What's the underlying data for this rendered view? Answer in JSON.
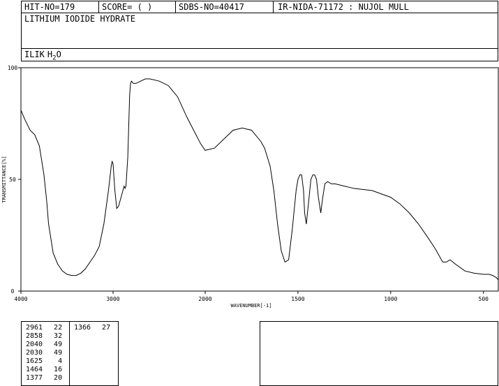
{
  "header": {
    "hit_no": "HIT-NO=179",
    "score": "SCORE=  (   )",
    "sdbs_no": "SDBS-NO=40417",
    "ir_code": "IR-NIDA-71172 : NUJOL MULL"
  },
  "compound": {
    "name": "LITHIUM IODIDE HYDRATE",
    "formula_prefix": "ILIK",
    "formula_h": "H",
    "formula_sub": "2",
    "formula_o": "O"
  },
  "peaks": {
    "left": [
      {
        "wavenumber": "2961",
        "transmittance": "22"
      },
      {
        "wavenumber": "2858",
        "transmittance": "32"
      },
      {
        "wavenumber": "2040",
        "transmittance": "49"
      },
      {
        "wavenumber": "2030",
        "transmittance": "49"
      },
      {
        "wavenumber": "1625",
        "transmittance": "4"
      },
      {
        "wavenumber": "1464",
        "transmittance": "16"
      },
      {
        "wavenumber": "1377",
        "transmittance": "20"
      }
    ],
    "right": [
      {
        "wavenumber": "1366",
        "transmittance": "27"
      }
    ]
  },
  "chart_data": {
    "type": "line",
    "xlabel": "WAVENUMBER[-1]",
    "ylabel": "TRANSMITTANCE[%]",
    "xlim": [
      4000,
      420
    ],
    "ylim": [
      0,
      100
    ],
    "xticks": [
      4000,
      3000,
      2000,
      1500,
      1000,
      500
    ],
    "yticks": [
      0,
      50,
      100
    ],
    "series": [
      {
        "x": [
          4000,
          3960,
          3900,
          3850,
          3800,
          3750,
          3720,
          3700,
          3650,
          3600,
          3550,
          3500,
          3450,
          3400,
          3350,
          3300,
          3250,
          3200,
          3150,
          3100,
          3050,
          3020,
          3010,
          3000,
          2980,
          2960,
          2940,
          2920,
          2900,
          2880,
          2870,
          2860,
          2840,
          2820,
          2810,
          2800,
          2780,
          2750,
          2700,
          2650,
          2600,
          2500,
          2400,
          2300,
          2200,
          2100,
          2050,
          2000,
          1950,
          1900,
          1850,
          1800,
          1750,
          1700,
          1680,
          1650,
          1630,
          1610,
          1590,
          1570,
          1550,
          1530,
          1510,
          1500,
          1490,
          1480,
          1470,
          1464,
          1455,
          1440,
          1430,
          1420,
          1410,
          1400,
          1390,
          1377,
          1366,
          1355,
          1340,
          1320,
          1300,
          1250,
          1200,
          1100,
          1000,
          950,
          900,
          850,
          800,
          760,
          740,
          720,
          700,
          680,
          650,
          600,
          550,
          500,
          470,
          450,
          430,
          420
        ],
        "y": [
          81,
          77,
          72,
          70,
          65,
          52,
          40,
          30,
          17,
          12,
          9,
          7.5,
          7,
          7,
          8,
          10,
          13,
          16,
          20,
          30,
          45,
          56,
          58,
          57,
          45,
          37,
          38,
          41,
          44,
          47,
          46,
          47,
          60,
          88,
          93,
          94,
          93,
          93,
          94,
          95,
          95,
          94,
          92,
          87,
          78,
          70,
          66,
          63,
          64,
          68,
          72,
          73,
          72,
          67,
          64,
          56,
          45,
          30,
          18,
          13,
          14,
          28,
          45,
          50,
          52,
          52,
          45,
          35,
          30,
          42,
          50,
          52,
          52,
          50,
          42,
          35,
          42,
          48,
          49,
          48,
          48,
          47,
          46,
          45,
          42,
          39,
          35,
          30,
          24,
          19,
          16,
          13,
          13,
          14,
          12,
          9,
          8,
          7.5,
          7.5,
          7,
          6,
          5
        ]
      }
    ]
  }
}
